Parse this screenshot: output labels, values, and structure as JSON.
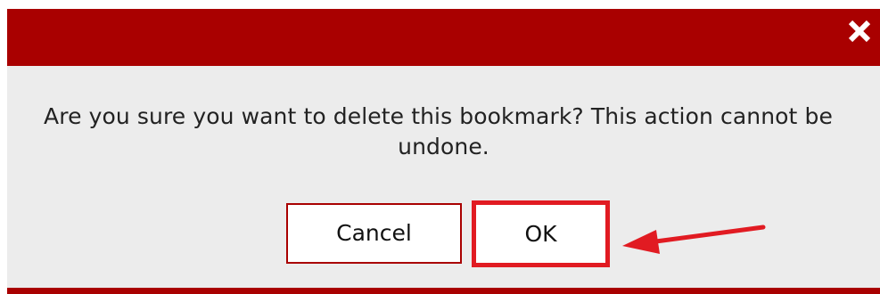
{
  "dialog": {
    "close_icon": "close-icon",
    "message_line1": "Are you sure you want to delete this bookmark? This action cannot be",
    "message_line2": "undone.",
    "cancel_label": "Cancel",
    "ok_label": "OK"
  },
  "colors": {
    "titlebar": "#a90000",
    "body_background": "#ececec",
    "ok_highlight": "#e11b22",
    "annotation_arrow": "#e11b22"
  }
}
